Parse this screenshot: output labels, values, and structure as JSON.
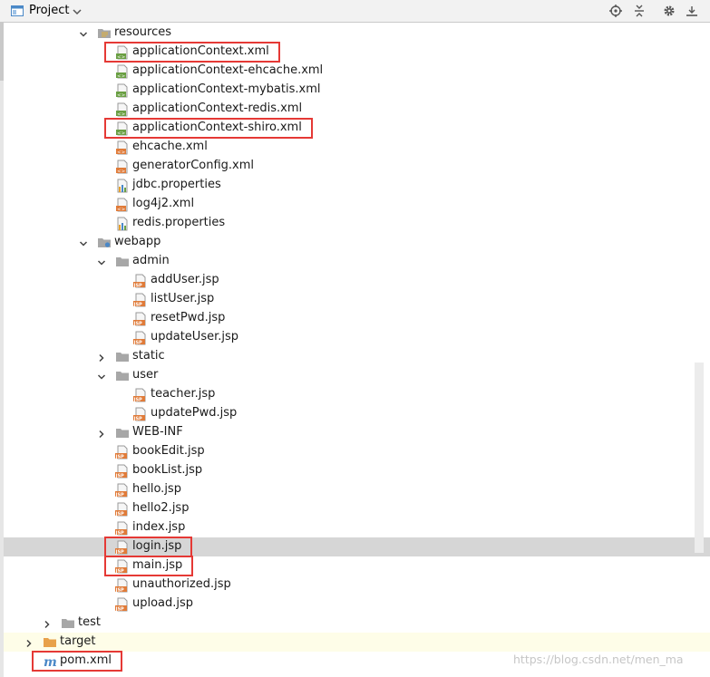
{
  "header": {
    "title": "Project",
    "icons": [
      "project-icon",
      "chevron-down-icon",
      "locate-icon",
      "collapse-all-icon",
      "gear-icon",
      "hide-icon"
    ]
  },
  "tree": [
    {
      "label": "resources",
      "icon": "resources-folder-icon",
      "level": 5,
      "expanded": true
    },
    {
      "label": "applicationContext.xml",
      "icon": "spring-xml-icon",
      "level": 6
    },
    {
      "label": "applicationContext-ehcache.xml",
      "icon": "spring-xml-icon",
      "level": 6
    },
    {
      "label": "applicationContext-mybatis.xml",
      "icon": "spring-xml-icon",
      "level": 6
    },
    {
      "label": "applicationContext-redis.xml",
      "icon": "spring-xml-icon",
      "level": 6
    },
    {
      "label": "applicationContext-shiro.xml",
      "icon": "spring-xml-icon",
      "level": 6
    },
    {
      "label": "ehcache.xml",
      "icon": "xml-file-icon",
      "level": 6
    },
    {
      "label": "generatorConfig.xml",
      "icon": "xml-file-icon",
      "level": 6
    },
    {
      "label": "jdbc.properties",
      "icon": "properties-file-icon",
      "level": 6
    },
    {
      "label": "log4j2.xml",
      "icon": "xml-file-icon",
      "level": 6
    },
    {
      "label": "redis.properties",
      "icon": "properties-file-icon",
      "level": 6
    },
    {
      "label": "webapp",
      "icon": "web-folder-icon",
      "level": 5,
      "expanded": true
    },
    {
      "label": "admin",
      "icon": "folder-icon",
      "level": 6,
      "expanded": true
    },
    {
      "label": "addUser.jsp",
      "icon": "jsp-file-icon",
      "level": 7
    },
    {
      "label": "listUser.jsp",
      "icon": "jsp-file-icon",
      "level": 7
    },
    {
      "label": "resetPwd.jsp",
      "icon": "jsp-file-icon",
      "level": 7
    },
    {
      "label": "updateUser.jsp",
      "icon": "jsp-file-icon",
      "level": 7
    },
    {
      "label": "static",
      "icon": "folder-icon",
      "level": 6,
      "expanded": false
    },
    {
      "label": "user",
      "icon": "folder-icon",
      "level": 6,
      "expanded": true
    },
    {
      "label": "teacher.jsp",
      "icon": "jsp-file-icon",
      "level": 7
    },
    {
      "label": "updatePwd.jsp",
      "icon": "jsp-file-icon",
      "level": 7
    },
    {
      "label": "WEB-INF",
      "icon": "folder-icon",
      "level": 6,
      "expanded": false
    },
    {
      "label": "bookEdit.jsp",
      "icon": "jsp-file-icon",
      "level": 6
    },
    {
      "label": "bookList.jsp",
      "icon": "jsp-file-icon",
      "level": 6
    },
    {
      "label": "hello.jsp",
      "icon": "jsp-file-icon",
      "level": 6
    },
    {
      "label": "hello2.jsp",
      "icon": "jsp-file-icon",
      "level": 6
    },
    {
      "label": "index.jsp",
      "icon": "jsp-file-icon",
      "level": 6
    },
    {
      "label": "login.jsp",
      "icon": "jsp-file-icon",
      "level": 6,
      "selected": true
    },
    {
      "label": "main.jsp",
      "icon": "jsp-file-icon",
      "level": 6
    },
    {
      "label": "unauthorized.jsp",
      "icon": "jsp-file-icon",
      "level": 6
    },
    {
      "label": "upload.jsp",
      "icon": "jsp-file-icon",
      "level": 6
    },
    {
      "label": "test",
      "icon": "folder-icon",
      "level": 3,
      "expanded": false
    },
    {
      "label": "target",
      "icon": "excluded-folder-icon",
      "level": 2,
      "expanded": false,
      "yellow": true
    },
    {
      "label": "pom.xml",
      "icon": "maven-icon",
      "level": 2
    }
  ],
  "highlighted_items": [
    "applicationContext.xml",
    "applicationContext-shiro.xml",
    "login.jsp",
    "main.jsp",
    "pom.xml"
  ],
  "colors": {
    "highlight_border": "#e53935",
    "selection": "#d6d6d6",
    "excluded_row": "#fefde8",
    "excluded_folder": "#e8a14a",
    "jsp_icon": "#e07b39",
    "folder": "#a7a7a7"
  },
  "watermark": "https://blog.csdn.net/men_ma"
}
